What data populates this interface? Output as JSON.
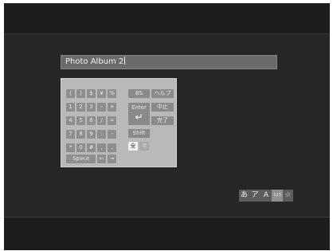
{
  "album_title": {
    "value": "Photo Album 2"
  },
  "keyboard": {
    "row1": [
      "(",
      ")",
      "$",
      "¥",
      "%"
    ],
    "bs_label": "BS",
    "help_label": "ヘルプ",
    "row2": [
      "1",
      "2",
      "3",
      "-",
      "+"
    ],
    "enter_label": "Enter",
    "enter_arrow": "↵",
    "cancel_label": "中止",
    "row3": [
      "4",
      "5",
      "6",
      "/",
      "="
    ],
    "done_label": "完了",
    "row4": [
      "7",
      "8",
      "9",
      ":",
      "-"
    ],
    "shift_label": "Shift",
    "row5": [
      "*",
      "0",
      "#",
      ",",
      "."
    ],
    "full_width_label": "全",
    "half_width_label": "半",
    "space_label": "Space",
    "left_arrow": "←",
    "right_arrow": "→"
  },
  "input_modes": {
    "hiragana": "あ",
    "katakana": "ア",
    "alphabet": "A",
    "numeric": "123",
    "symbol": "☆",
    "active": "numeric"
  }
}
